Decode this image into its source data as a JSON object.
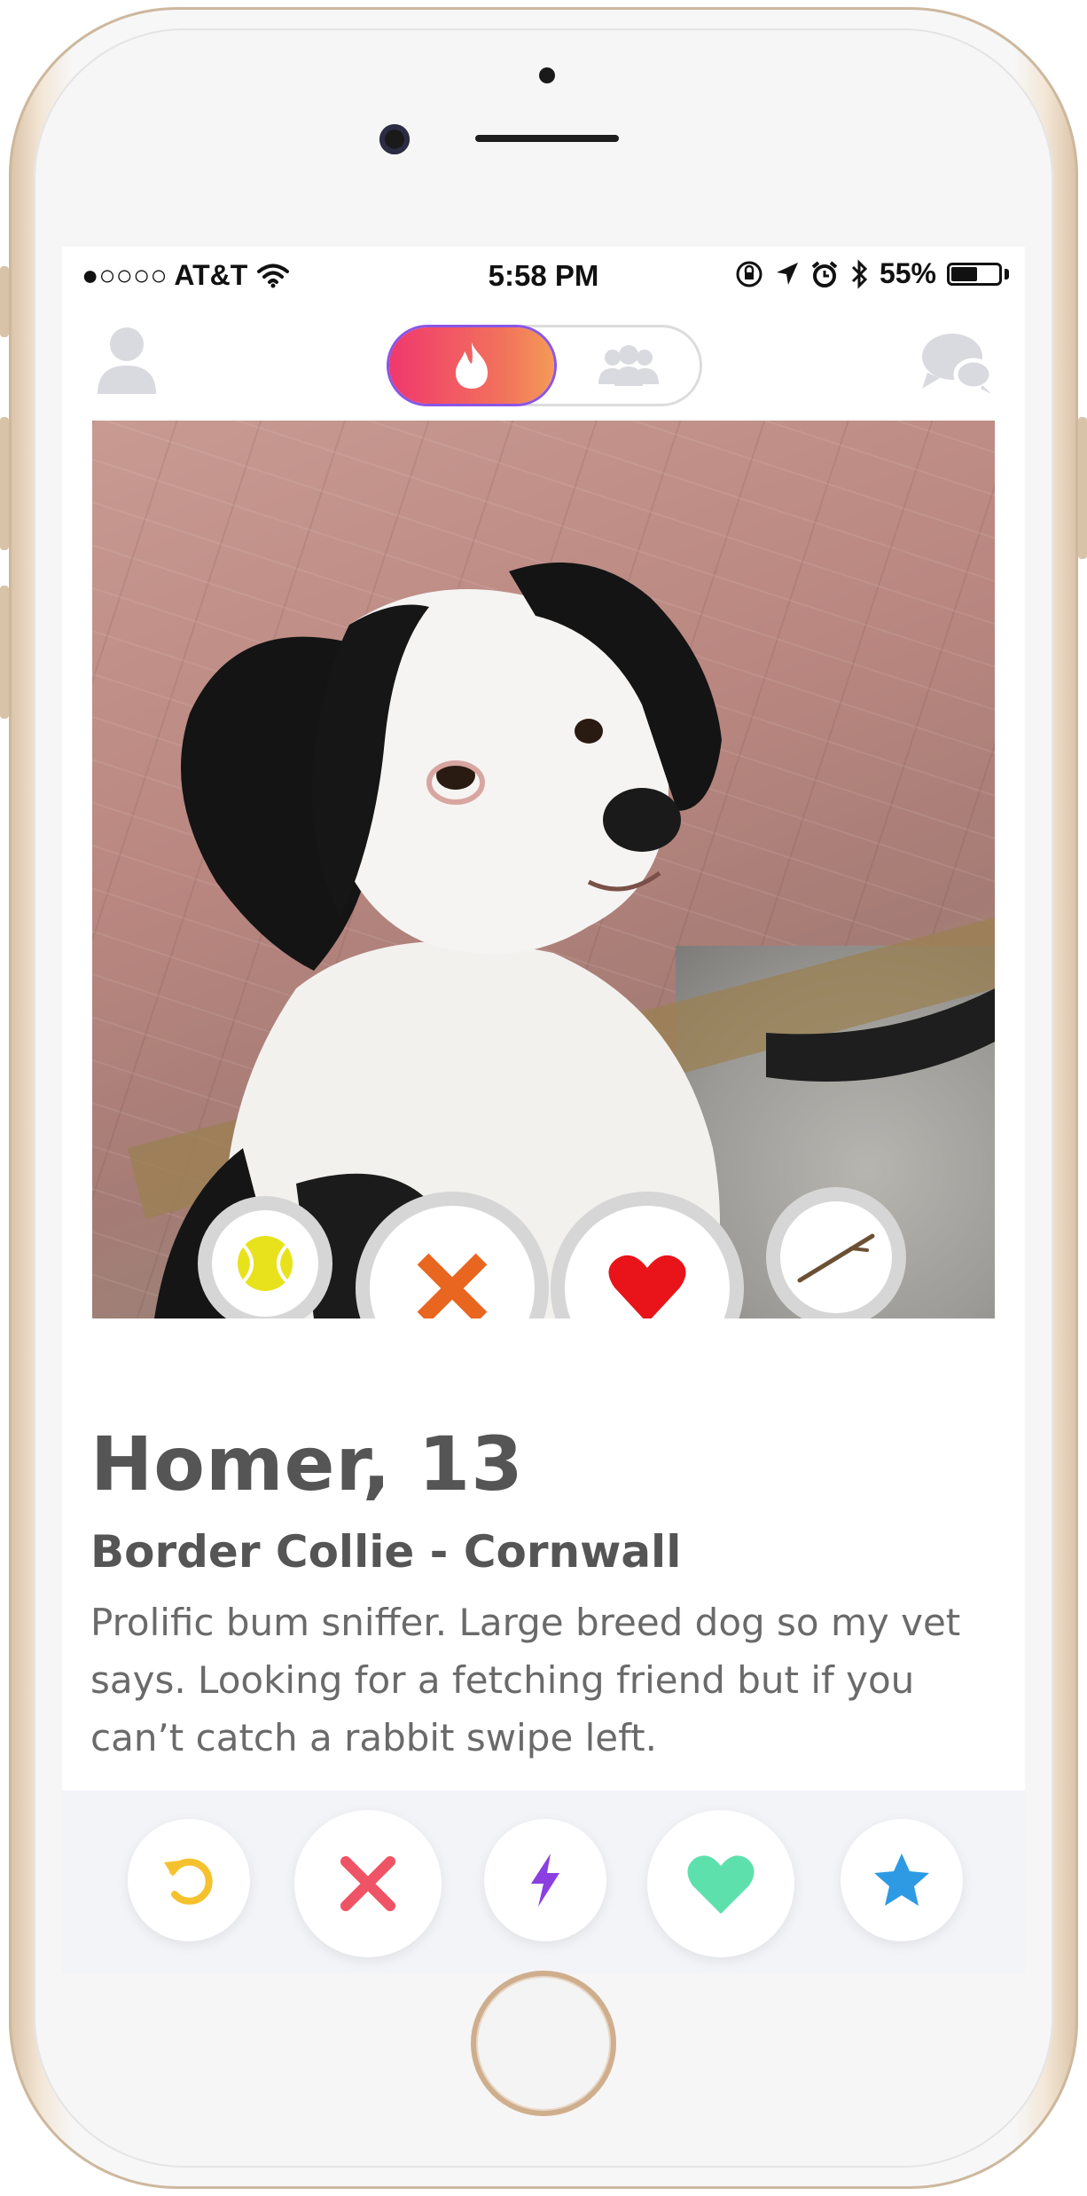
{
  "status_bar": {
    "carrier": "●○○○○ AT&T",
    "time": "5:58 PM",
    "battery": "55%",
    "battery_level": 0.55
  },
  "nav": {
    "profile_icon": "person-icon",
    "toggle_active_icon": "flame-icon",
    "toggle_inactive_icon": "group-icon",
    "chat_icon": "chat-bubbles-icon",
    "brand_gradient": [
      "#f0386d",
      "#f59a57"
    ]
  },
  "photo_actions": [
    {
      "icon": "tennis-ball-icon",
      "color": "#e8e21c"
    },
    {
      "icon": "x-icon",
      "color": "#e8661f"
    },
    {
      "icon": "heart-icon",
      "color": "#e8141a"
    },
    {
      "icon": "stick-icon",
      "color": "#6b5033"
    }
  ],
  "profile": {
    "name_age": "Homer, 13",
    "breed_location": "Border Collie - Cornwall",
    "bio": "Prolific bum sniffer. Large breed dog so my vet says. Looking for a fetching friend but if you can’t catch a rabbit swipe left."
  },
  "action_bar": [
    {
      "icon": "rewind-icon",
      "color": "#f5c22e"
    },
    {
      "icon": "nope-icon",
      "color": "#ef5466"
    },
    {
      "icon": "boost-icon",
      "color": "#8b3fe0"
    },
    {
      "icon": "like-heart-icon",
      "color": "#5ee0ad"
    },
    {
      "icon": "super-like-star-icon",
      "color": "#2e9ae4"
    }
  ]
}
